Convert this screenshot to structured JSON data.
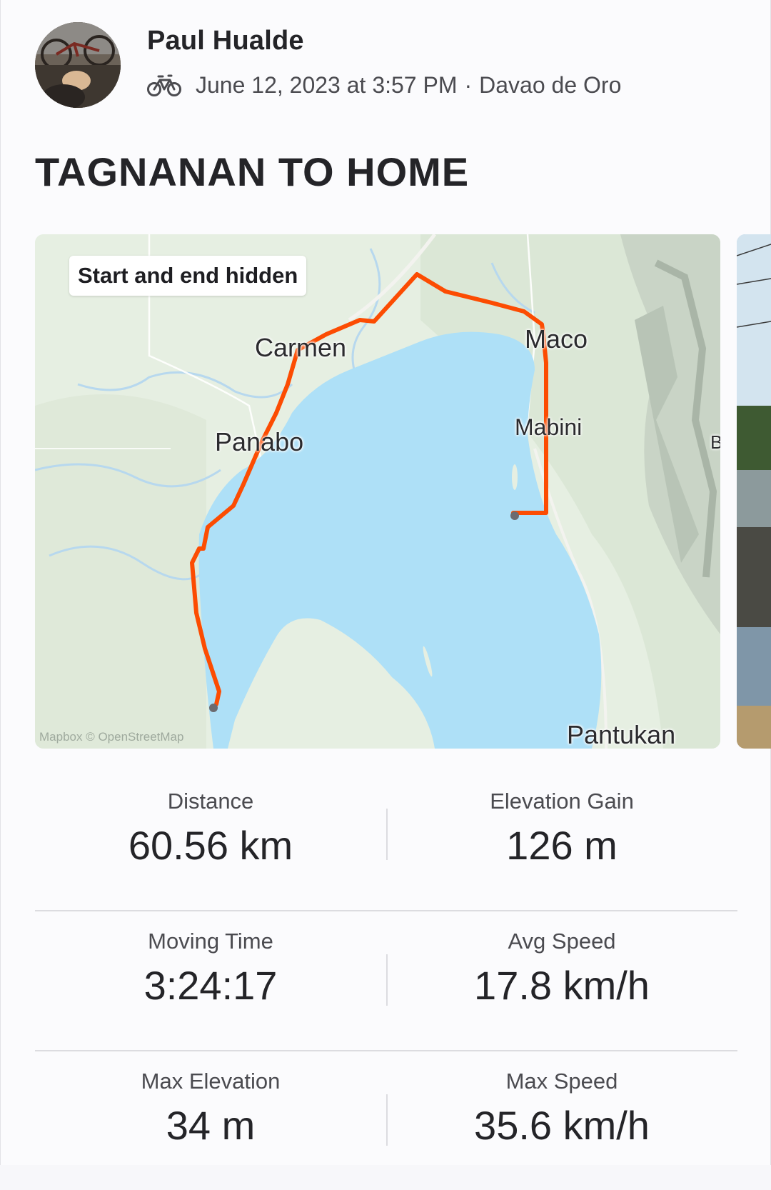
{
  "athlete": {
    "name": "Paul Hualde"
  },
  "activity": {
    "sport_icon": "bike-icon",
    "date_time": "June 12, 2023 at 3:57 PM",
    "separator": "·",
    "location": "Davao de Oro",
    "title": "TAGNANAN TO HOME"
  },
  "map": {
    "privacy_badge": "Start and end hidden",
    "labels": {
      "carmen": "Carmen",
      "panabo": "Panabo",
      "maco": "Maco",
      "mabini": "Mabini",
      "pantukan": "Pantukan",
      "edge": "B"
    },
    "attribution": "Mapbox © OpenStreetMap",
    "route_color": "#fc4c02",
    "water_color": "#aee0f7",
    "land_color": "#e6efe2"
  },
  "stats": {
    "distance": {
      "label": "Distance",
      "value": "60.56 km"
    },
    "elevation_gain": {
      "label": "Elevation Gain",
      "value": "126 m"
    },
    "moving_time": {
      "label": "Moving Time",
      "value": "3:24:17"
    },
    "avg_speed": {
      "label": "Avg Speed",
      "value": "17.8 km/h"
    },
    "max_elevation": {
      "label": "Max Elevation",
      "value": "34 m"
    },
    "max_speed": {
      "label": "Max Speed",
      "value": "35.6 km/h"
    }
  }
}
